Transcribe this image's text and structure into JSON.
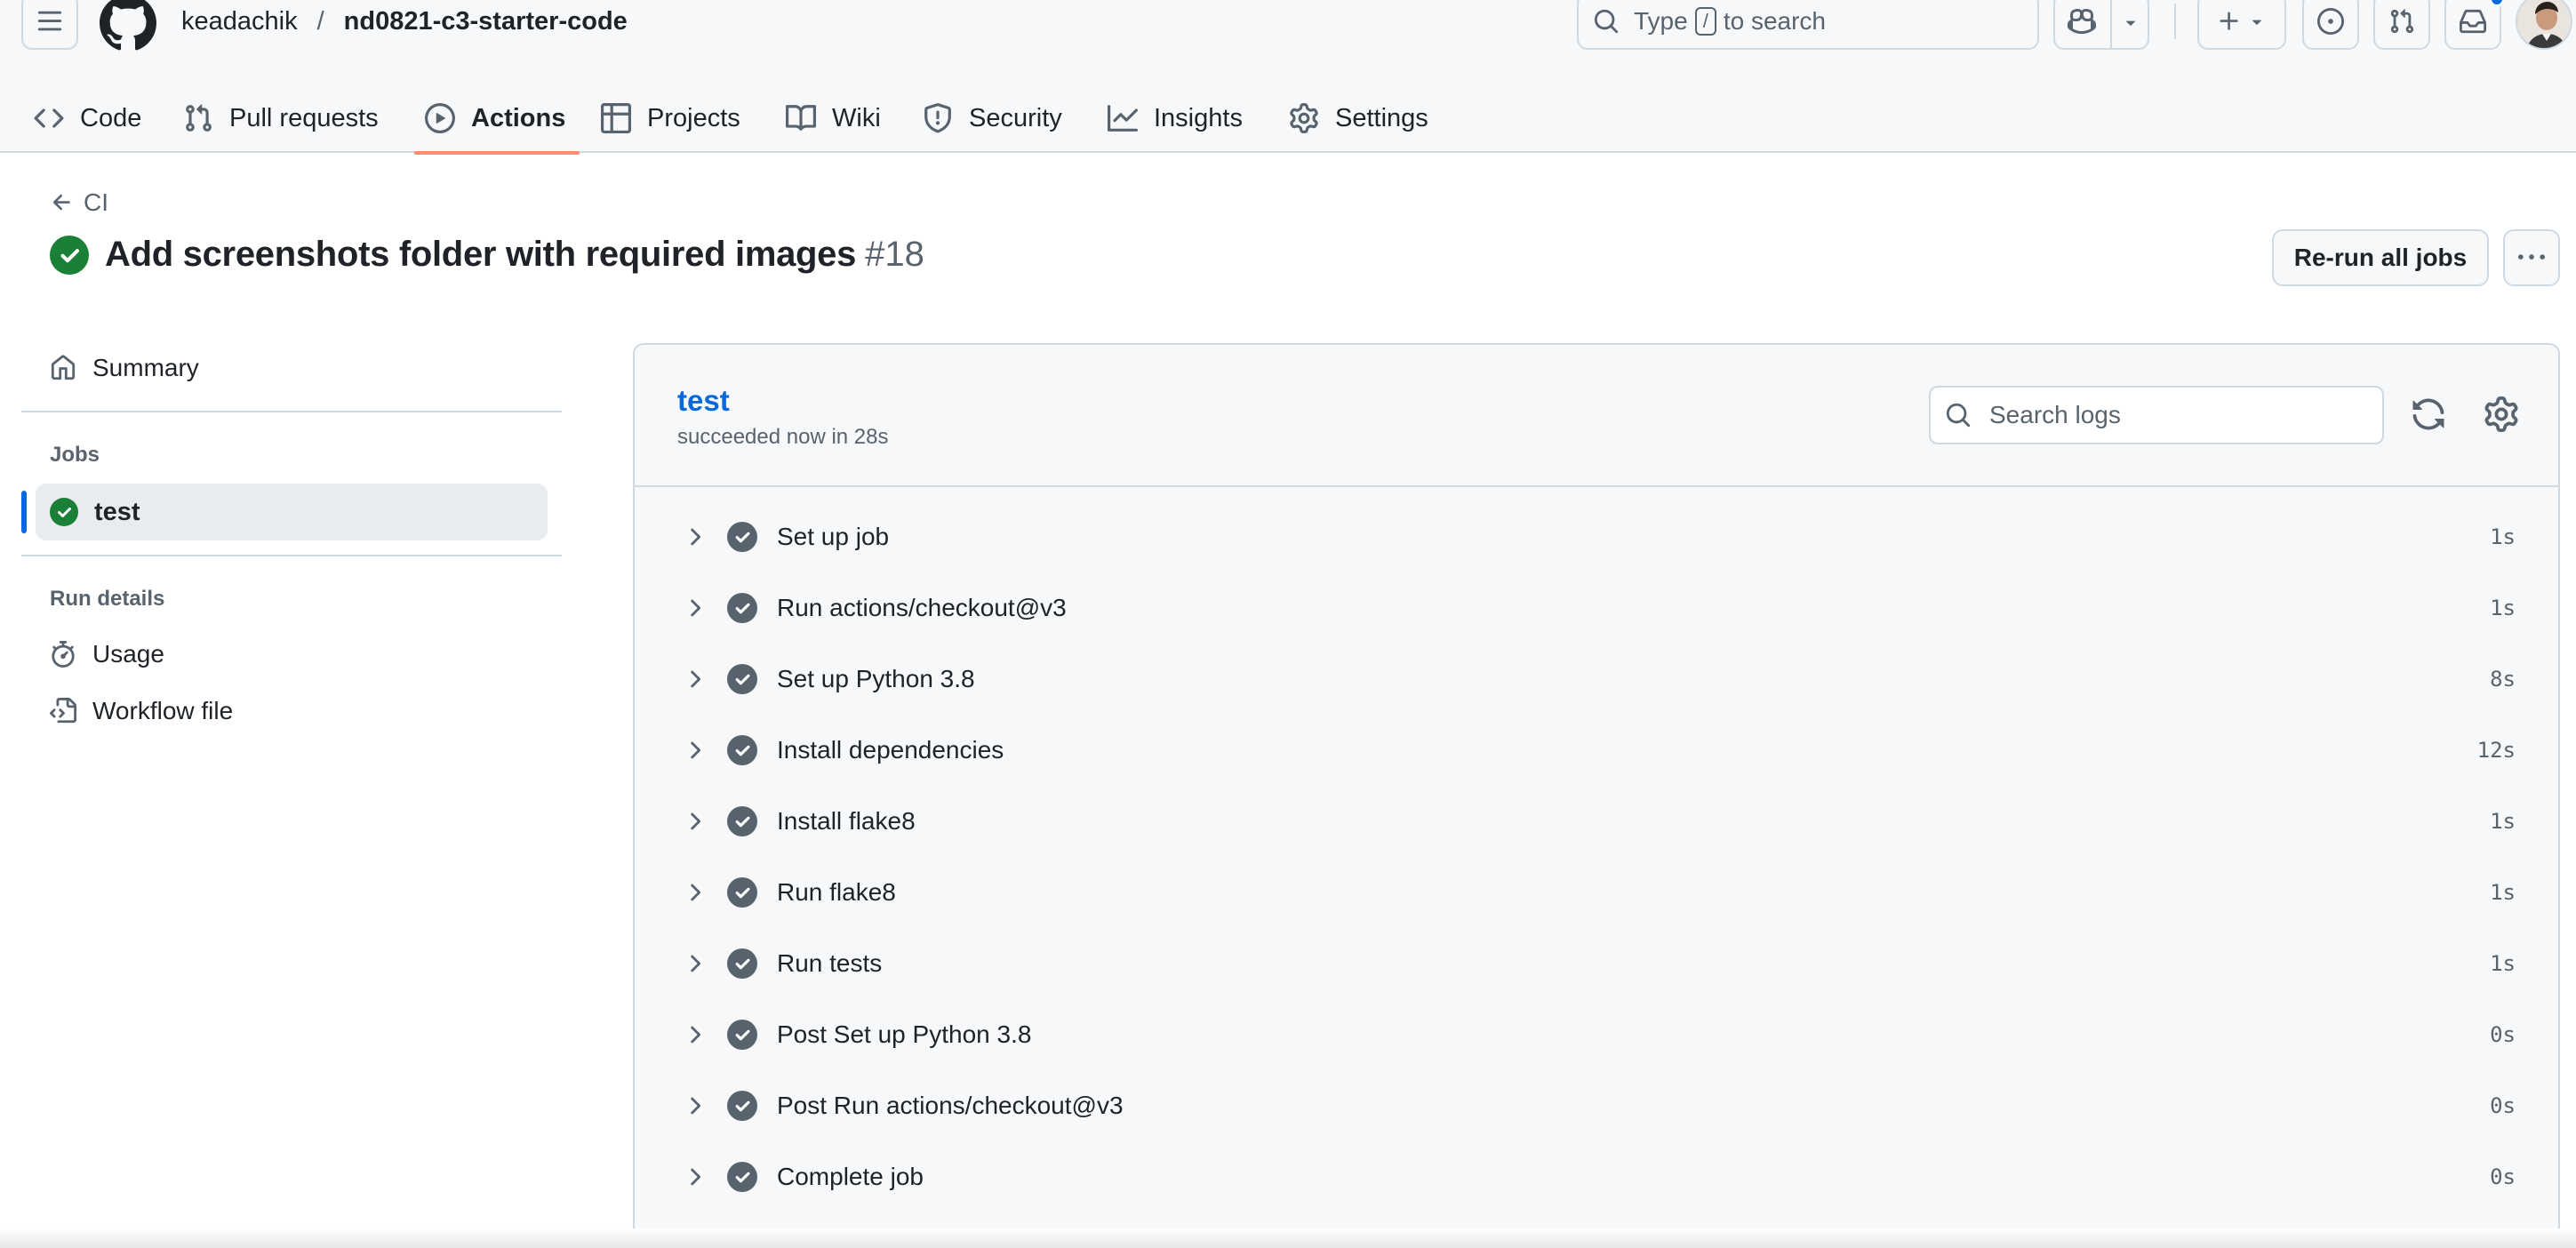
{
  "header": {
    "owner": "keadachik",
    "separator": "/",
    "repo": "nd0821-c3-starter-code",
    "search": {
      "prefix": "Type",
      "key": "/",
      "suffix": "to search"
    },
    "tabs": [
      {
        "label": "Code",
        "icon": "code-icon"
      },
      {
        "label": "Pull requests",
        "icon": "git-pull-request-icon"
      },
      {
        "label": "Actions",
        "icon": "play-icon",
        "active": true
      },
      {
        "label": "Projects",
        "icon": "table-icon"
      },
      {
        "label": "Wiki",
        "icon": "book-icon"
      },
      {
        "label": "Security",
        "icon": "shield-icon"
      },
      {
        "label": "Insights",
        "icon": "graph-icon"
      },
      {
        "label": "Settings",
        "icon": "gear-icon"
      }
    ]
  },
  "run": {
    "back_label": "CI",
    "title": "Add screenshots folder with required images",
    "number": "#18",
    "rerun_label": "Re-run all jobs"
  },
  "sidebar": {
    "summary_label": "Summary",
    "jobs_heading": "Jobs",
    "job_label": "test",
    "run_details_heading": "Run details",
    "usage_label": "Usage",
    "workflow_file_label": "Workflow file"
  },
  "job": {
    "name": "test",
    "status": "succeeded now in 28s",
    "search_placeholder": "Search logs",
    "steps": [
      {
        "name": "Set up job",
        "duration": "1s"
      },
      {
        "name": "Run actions/checkout@v3",
        "duration": "1s"
      },
      {
        "name": "Set up Python 3.8",
        "duration": "8s"
      },
      {
        "name": "Install dependencies",
        "duration": "12s"
      },
      {
        "name": "Install flake8",
        "duration": "1s"
      },
      {
        "name": "Run flake8",
        "duration": "1s"
      },
      {
        "name": "Run tests",
        "duration": "1s"
      },
      {
        "name": "Post Set up Python 3.8",
        "duration": "0s"
      },
      {
        "name": "Post Run actions/checkout@v3",
        "duration": "0s"
      },
      {
        "name": "Complete job",
        "duration": "0s"
      }
    ]
  },
  "colors": {
    "success": "#1a7f37",
    "step_check": "#59636e",
    "link": "#0969da",
    "active_tab_underline": "#fd8c73"
  }
}
